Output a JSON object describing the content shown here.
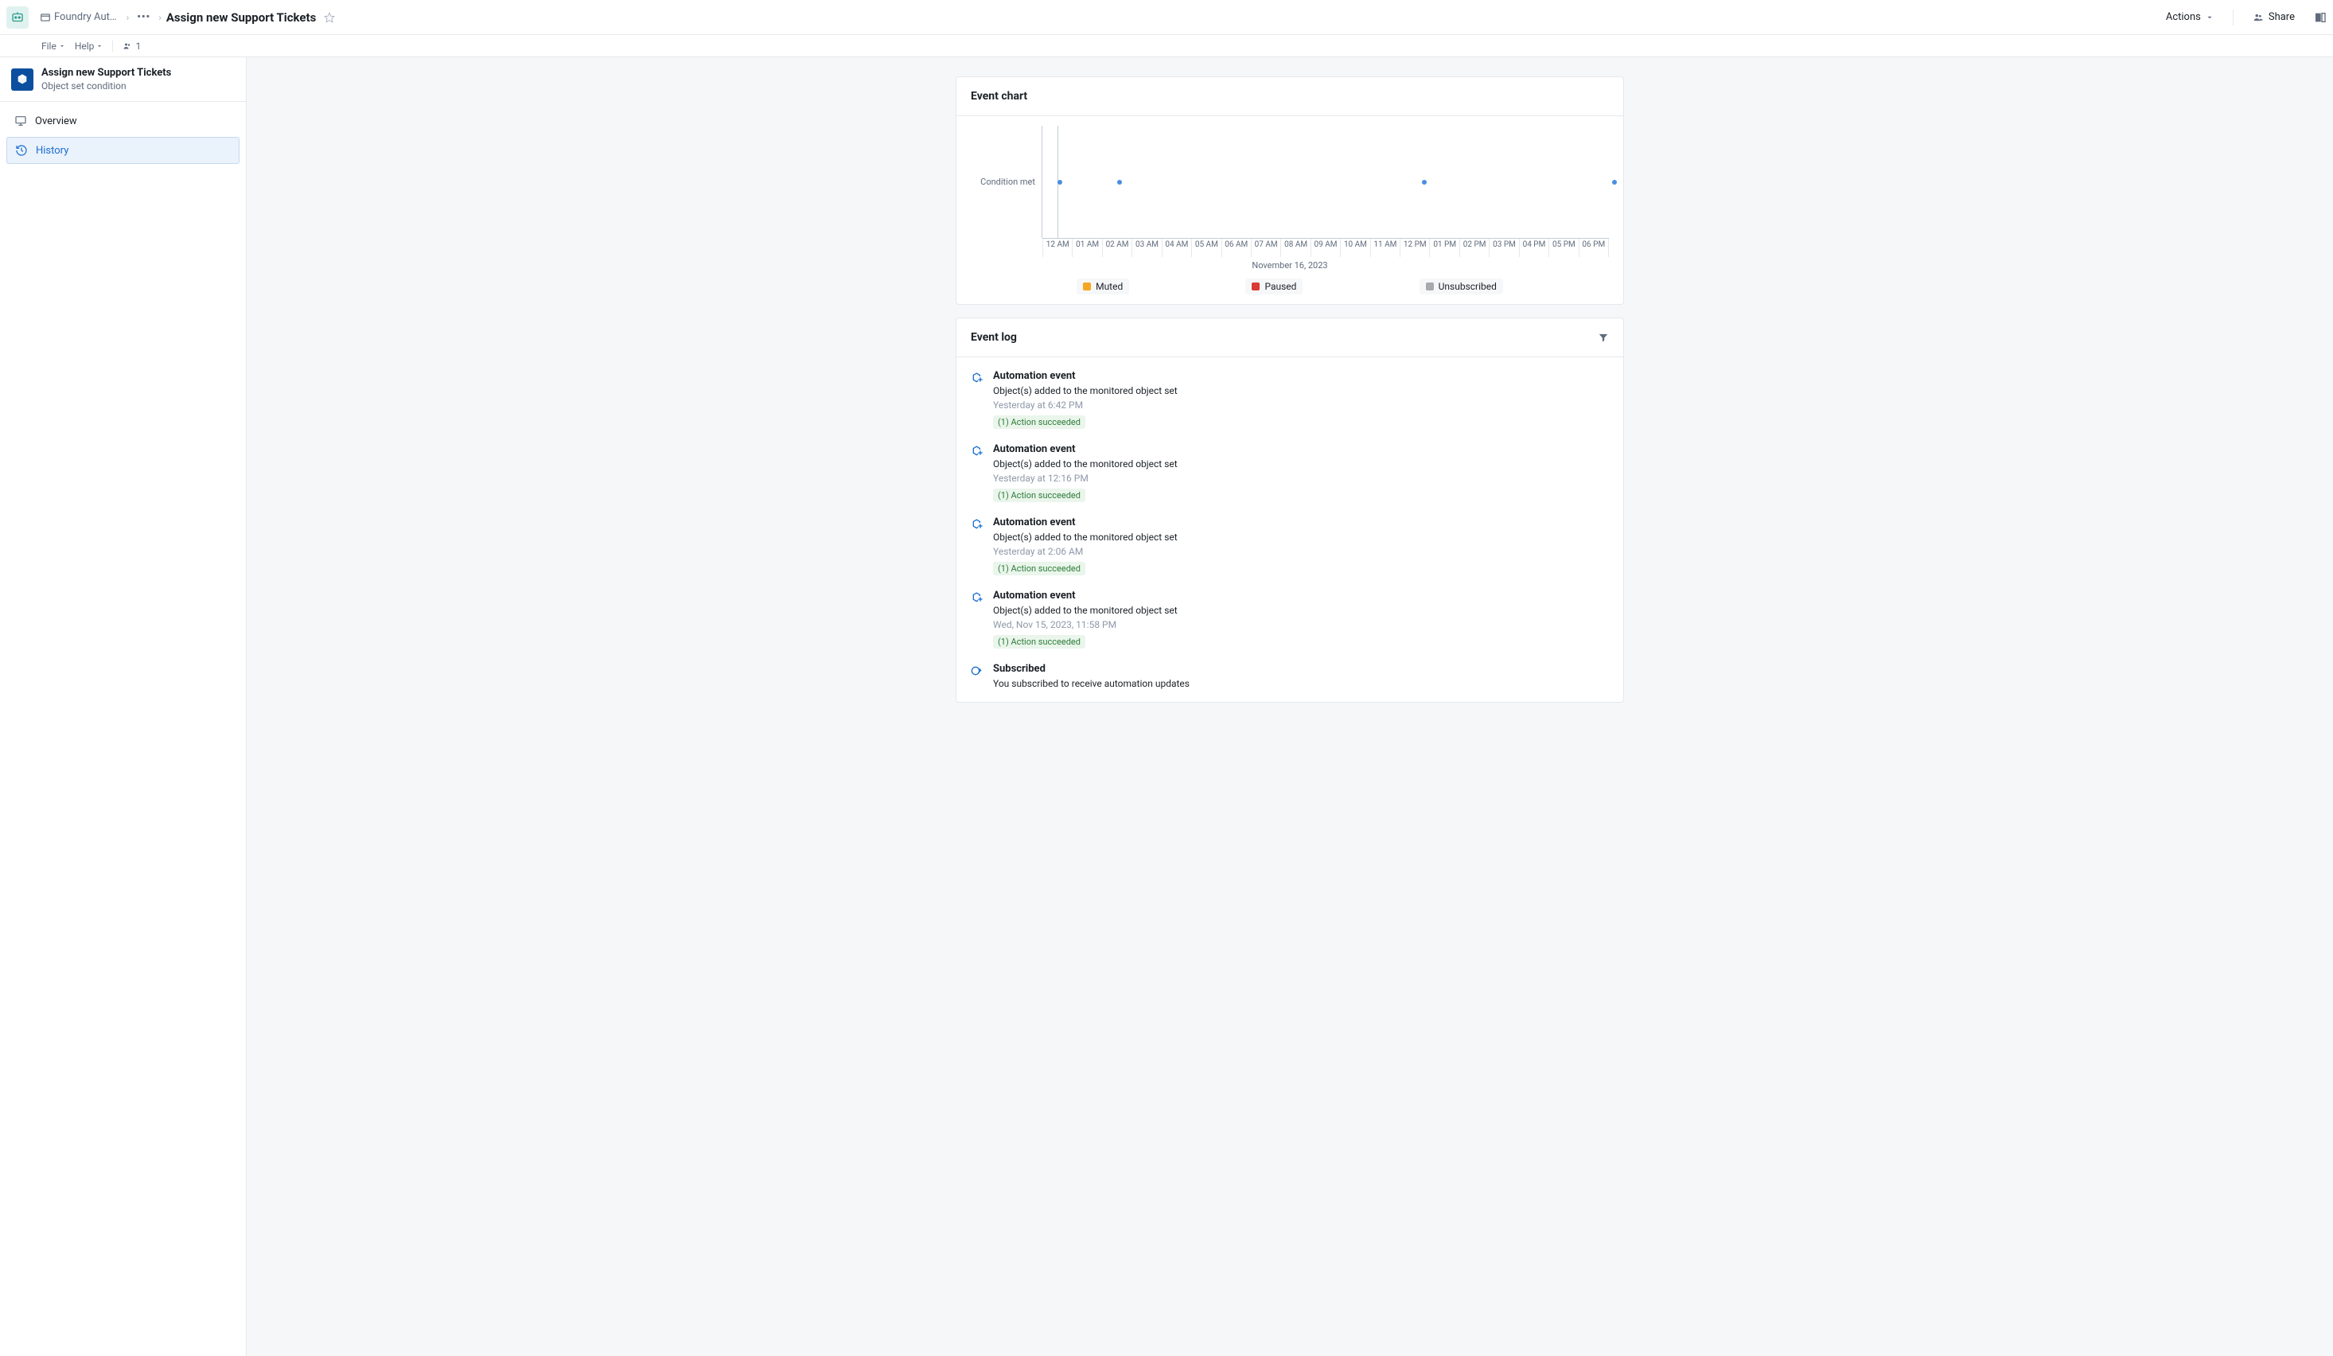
{
  "header": {
    "breadcrumb_project": "Foundry Aut…",
    "page_title": "Assign new Support Tickets",
    "actions_label": "Actions",
    "share_label": "Share"
  },
  "menubar": {
    "file": "File",
    "help": "Help",
    "user_count": "1"
  },
  "sidebar": {
    "title": "Assign new Support Tickets",
    "subtitle": "Object set condition",
    "nav": [
      {
        "label": "Overview",
        "icon": "monitor",
        "selected": false
      },
      {
        "label": "History",
        "icon": "history",
        "selected": true
      }
    ]
  },
  "chart": {
    "title": "Event chart",
    "y_label": "Condition met",
    "date_label": "November 16, 2023",
    "legend": [
      {
        "label": "Muted",
        "color": "#f5a623"
      },
      {
        "label": "Paused",
        "color": "#d93a35"
      },
      {
        "label": "Unsubscribed",
        "color": "#a7a9ac"
      }
    ]
  },
  "chart_data": {
    "type": "scatter",
    "y_categories": [
      "Condition met"
    ],
    "x_ticks": [
      "12 AM",
      "01 AM",
      "02 AM",
      "03 AM",
      "04 AM",
      "05 AM",
      "06 AM",
      "07 AM",
      "08 AM",
      "09 AM",
      "10 AM",
      "11 AM",
      "12 PM",
      "01 PM",
      "02 PM",
      "03 PM",
      "04 PM",
      "05 PM",
      "06 PM"
    ],
    "x_range_hours": [
      -0.5,
      18.5
    ],
    "points": [
      {
        "x_hour": 0.1,
        "y": "Condition met"
      },
      {
        "x_hour": 2.1,
        "y": "Condition met"
      },
      {
        "x_hour": 12.3,
        "y": "Condition met"
      },
      {
        "x_hour": 18.7,
        "y": "Condition met"
      }
    ]
  },
  "event_log": {
    "title": "Event log",
    "items": [
      {
        "icon": "cube-add",
        "title": "Automation event",
        "desc": "Object(s) added to the monitored object set",
        "time": "Yesterday at 6:42 PM",
        "badge": "(1) Action succeeded"
      },
      {
        "icon": "cube-add",
        "title": "Automation event",
        "desc": "Object(s) added to the monitored object set",
        "time": "Yesterday at 12:16 PM",
        "badge": "(1) Action succeeded"
      },
      {
        "icon": "cube-add",
        "title": "Automation event",
        "desc": "Object(s) added to the monitored object set",
        "time": "Yesterday at 2:06 AM",
        "badge": "(1) Action succeeded"
      },
      {
        "icon": "cube-add",
        "title": "Automation event",
        "desc": "Object(s) added to the monitored object set",
        "time": "Wed, Nov 15, 2023, 11:58 PM",
        "badge": "(1) Action succeeded"
      },
      {
        "icon": "subscribe",
        "title": "Subscribed",
        "desc": "You subscribed to receive automation updates",
        "time": "",
        "badge": ""
      }
    ]
  }
}
